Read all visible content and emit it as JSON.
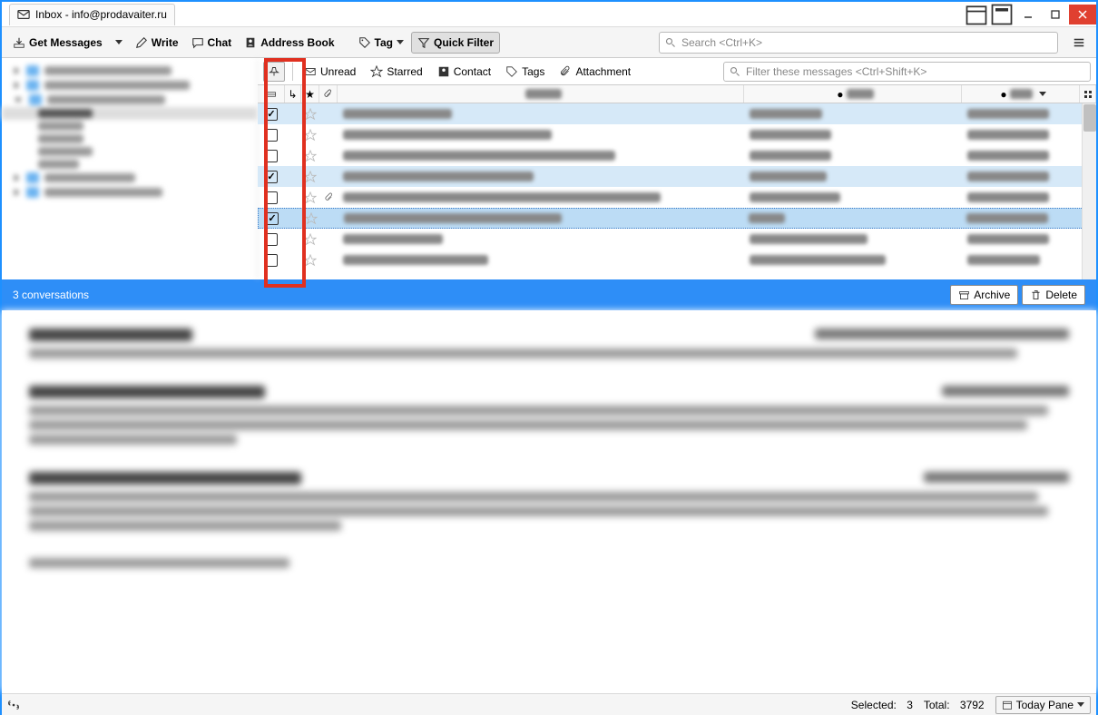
{
  "window": {
    "tab_title": "Inbox - info@prodavaiter.ru"
  },
  "toolbar": {
    "get_messages": "Get Messages",
    "write": "Write",
    "chat": "Chat",
    "address_book": "Address Book",
    "tag": "Tag",
    "quick_filter": "Quick Filter",
    "search_placeholder": "Search <Ctrl+K>"
  },
  "filterbar": {
    "unread": "Unread",
    "starred": "Starred",
    "contact": "Contact",
    "tags": "Tags",
    "attachment": "Attachment",
    "filter_placeholder": "Filter these messages <Ctrl+Shift+K>"
  },
  "messages": [
    {
      "checked": true,
      "selected": true,
      "focused": false,
      "hasAtt": false,
      "subW": 120,
      "fromW": 80,
      "dateW": 90
    },
    {
      "checked": false,
      "selected": false,
      "focused": false,
      "hasAtt": false,
      "subW": 230,
      "fromW": 90,
      "dateW": 90
    },
    {
      "checked": false,
      "selected": false,
      "focused": false,
      "hasAtt": false,
      "subW": 300,
      "fromW": 90,
      "dateW": 90
    },
    {
      "checked": true,
      "selected": true,
      "focused": false,
      "hasAtt": false,
      "subW": 210,
      "fromW": 85,
      "dateW": 90
    },
    {
      "checked": false,
      "selected": false,
      "focused": false,
      "hasAtt": true,
      "subW": 350,
      "fromW": 100,
      "dateW": 90
    },
    {
      "checked": true,
      "selected": true,
      "focused": true,
      "hasAtt": false,
      "subW": 240,
      "fromW": 40,
      "dateW": 90
    },
    {
      "checked": false,
      "selected": false,
      "focused": false,
      "hasAtt": false,
      "subW": 110,
      "fromW": 130,
      "dateW": 90
    },
    {
      "checked": false,
      "selected": false,
      "focused": false,
      "hasAtt": false,
      "subW": 160,
      "fromW": 150,
      "dateW": 80
    }
  ],
  "conversation": {
    "header": "3 conversations",
    "archive": "Archive",
    "delete": "Delete"
  },
  "status": {
    "selected_label": "Selected:",
    "selected_value": "3",
    "total_label": "Total:",
    "total_value": "3792",
    "today_pane": "Today Pane"
  }
}
